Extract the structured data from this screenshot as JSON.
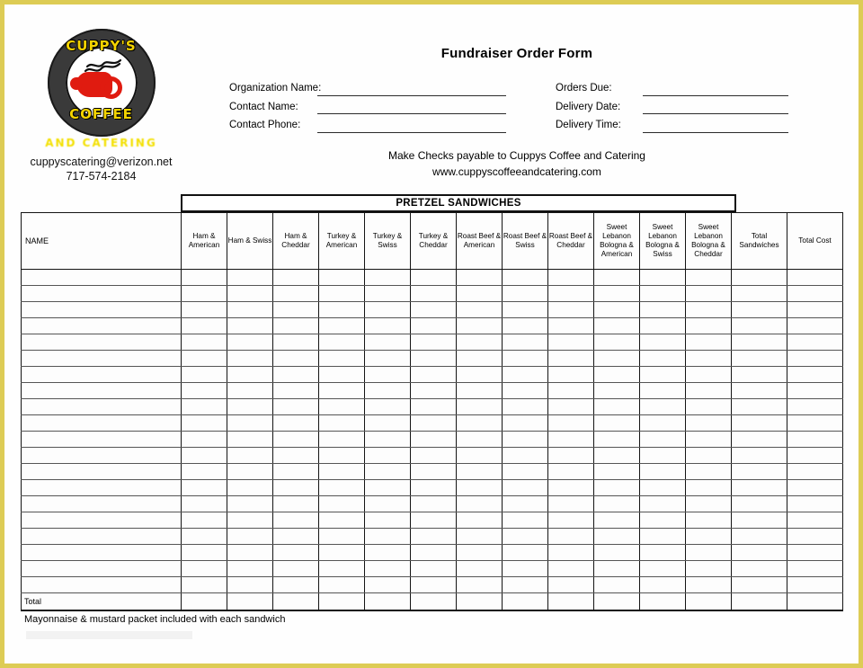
{
  "page": {
    "border_color": "#ddcc55",
    "background": "#ffffff"
  },
  "logo": {
    "top_text": "CUPPY'S",
    "bottom_text": "COFFEE",
    "subtitle": "AND CATERING",
    "ring_color": "#3a3a3a",
    "text_color": "#f5d400",
    "cup_color": "#e01b10",
    "email": "cuppyscatering@verizon.net",
    "phone": "717-574-2184"
  },
  "header": {
    "title": "Fundraiser Order Form",
    "left_fields": [
      {
        "label": "Organization Name:",
        "value": ""
      },
      {
        "label": "Contact Name:",
        "value": ""
      },
      {
        "label": "Contact Phone:",
        "value": ""
      }
    ],
    "right_fields": [
      {
        "label": "Orders Due:",
        "value": ""
      },
      {
        "label": "Delivery Date:",
        "value": ""
      },
      {
        "label": "Delivery Time:",
        "value": ""
      }
    ],
    "checks_note": "Make Checks payable to Cuppys Coffee and Catering",
    "website": "www.cuppyscoffeeandcatering.com"
  },
  "table": {
    "banner": "PRETZEL SANDWICHES",
    "name_header": "NAME",
    "columns": [
      "Ham & American",
      "Ham & Swiss",
      "Ham & Cheddar",
      "Turkey & American",
      "Turkey & Swiss",
      "Turkey & Cheddar",
      "Roast Beef & American",
      "Roast Beef & Swiss",
      "Roast Beef & Cheddar",
      "Sweet Lebanon Bologna & American",
      "Sweet Lebanon Bologna & Swiss",
      "Sweet Lebanon Bologna & Cheddar"
    ],
    "summary_columns": [
      "Total Sandwiches",
      "Total Cost"
    ],
    "body_row_count": 20,
    "total_label": "Total"
  },
  "footer": {
    "note": "Mayonnaise & mustard packet included with each sandwich"
  }
}
